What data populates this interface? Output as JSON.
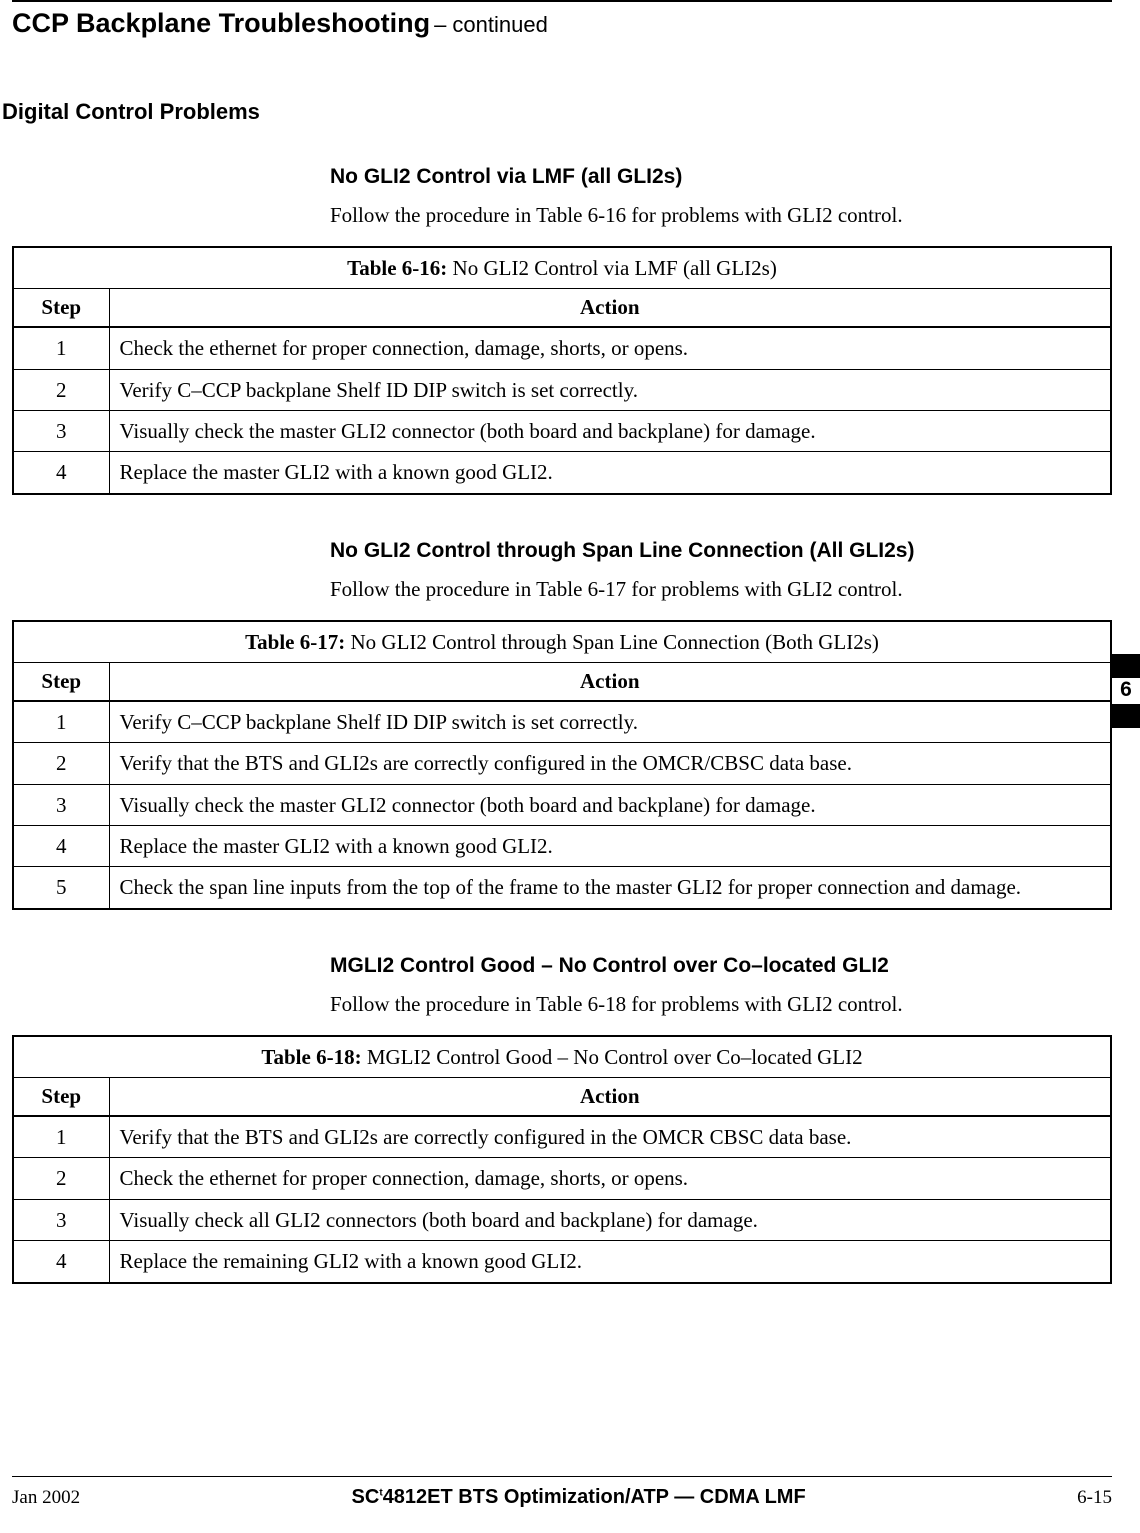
{
  "header": {
    "title": "CCP Backplane Troubleshooting",
    "continued": " – continued"
  },
  "section_heading": "Digital Control Problems",
  "subsections": [
    {
      "heading": "No GLI2 Control via LMF (all GLI2s)",
      "paragraph": "Follow the procedure in Table 6-16 for problems with GLI2 control.",
      "table_label": "Table 6-16:",
      "table_title": " No GLI2 Control via LMF (all GLI2s)",
      "col_step": "Step",
      "col_action": "Action",
      "rows": [
        {
          "step": "1",
          "action": "Check the ethernet for proper connection, damage, shorts, or opens."
        },
        {
          "step": "2",
          "action": "Verify C–CCP backplane Shelf ID DIP switch is set correctly."
        },
        {
          "step": "3",
          "action": "Visually check the master GLI2 connector (both board and backplane) for damage."
        },
        {
          "step": "4",
          "action": "Replace the master GLI2 with a known good GLI2."
        }
      ]
    },
    {
      "heading": "No GLI2 Control through Span Line Connection (All GLI2s)",
      "paragraph": "Follow the procedure in Table 6-17 for problems with GLI2 control.",
      "table_label": "Table 6-17:",
      "table_title": " No GLI2 Control through Span Line Connection (Both GLI2s)",
      "col_step": "Step",
      "col_action": "Action",
      "rows": [
        {
          "step": "1",
          "action": "Verify C–CCP backplane Shelf ID DIP switch is set correctly."
        },
        {
          "step": "2",
          "action": "Verify that the BTS and GLI2s are correctly configured in the OMCR/CBSC data base."
        },
        {
          "step": "3",
          "action": "Visually check the master GLI2 connector (both board and backplane) for damage."
        },
        {
          "step": "4",
          "action": "Replace the master GLI2 with a known good GLI2."
        },
        {
          "step": "5",
          "action": "Check the span line inputs from the top of the frame to the master GLI2 for proper connection and damage."
        }
      ]
    },
    {
      "heading": "MGLI2 Control Good – No Control over Co–located GLI2",
      "paragraph": "Follow the procedure in Table 6-18 for problems with GLI2 control.",
      "table_label": "Table 6-18:",
      "table_title": " MGLI2 Control Good – No Control over Co–located GLI2",
      "col_step": "Step",
      "col_action": "Action",
      "rows": [
        {
          "step": "1",
          "action": "Verify that the BTS and GLI2s are correctly configured in the OMCR CBSC data base."
        },
        {
          "step": "2",
          "action": "Check the ethernet for proper connection, damage, shorts, or opens."
        },
        {
          "step": "3",
          "action": "Visually check all GLI2 connectors (both board and backplane) for damage."
        },
        {
          "step": "4",
          "action": "Replace the remaining GLI2 with a known good GLI2."
        }
      ]
    }
  ],
  "side_tab": "6",
  "footer": {
    "left": "Jan 2002",
    "center_prefix": "SC",
    "center_tm": "t",
    "center_rest": "4812ET BTS Optimization/ATP — CDMA LMF",
    "right": "6-15"
  }
}
